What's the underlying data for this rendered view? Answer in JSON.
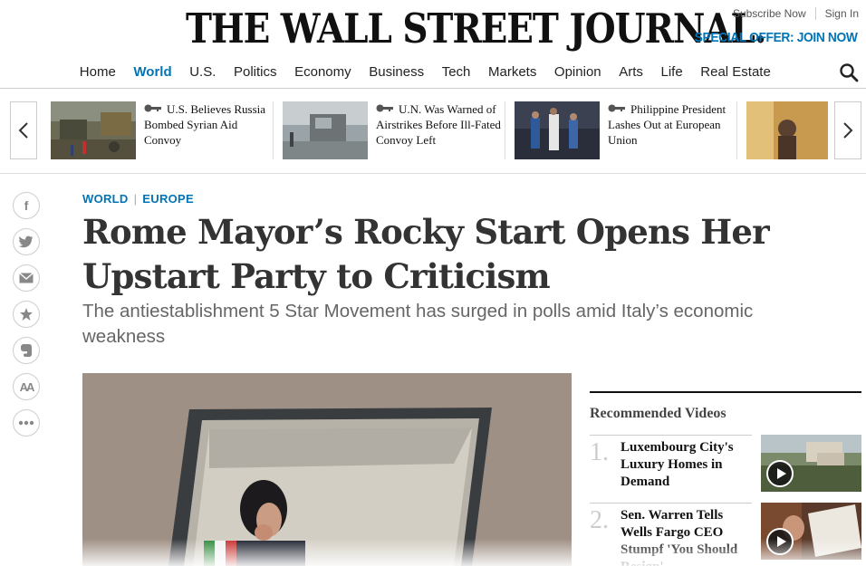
{
  "masthead": {
    "logo": "THE WALL STREET JOURNAL.",
    "subscribe": "Subscribe Now",
    "signin": "Sign In",
    "offer": "SPECIAL OFFER: JOIN NOW",
    "accent_color": "#0274b6"
  },
  "nav": {
    "items": [
      "Home",
      "World",
      "U.S.",
      "Politics",
      "Economy",
      "Business",
      "Tech",
      "Markets",
      "Opinion",
      "Arts",
      "Life",
      "Real Estate"
    ],
    "active": "World",
    "search_icon": "search-icon"
  },
  "carousel": {
    "cards": [
      {
        "title": "U.S. Believes Russia Bombed Syrian Aid Convoy",
        "locked": true
      },
      {
        "title": "U.N. Was Warned of Airstrikes Before Ill-Fated Convoy Left",
        "locked": true
      },
      {
        "title": "Philippine President Lashes Out at European Union",
        "locked": true
      },
      {
        "title": "",
        "locked": false
      }
    ]
  },
  "share": {
    "icons": [
      "facebook-icon",
      "twitter-icon",
      "email-icon",
      "bookmark-star-icon",
      "evernote-icon",
      "text-size-icon",
      "more-icon"
    ]
  },
  "article": {
    "kicker_section": "WORLD",
    "kicker_sub": "EUROPE",
    "headline": "Rome Mayor’s Rocky Start Opens Her Upstart Party to Criticism",
    "dek": "The antiestablishment 5 Star Movement has surged in polls amid Italy’s economic weakness"
  },
  "recommended": {
    "title": "Recommended Videos",
    "items": [
      {
        "num": "1.",
        "title": "Luxembourg City's Luxury Homes in Demand"
      },
      {
        "num": "2.",
        "title": "Sen. Warren Tells Wells Fargo CEO Stumpf 'You Should Resign'"
      }
    ]
  }
}
